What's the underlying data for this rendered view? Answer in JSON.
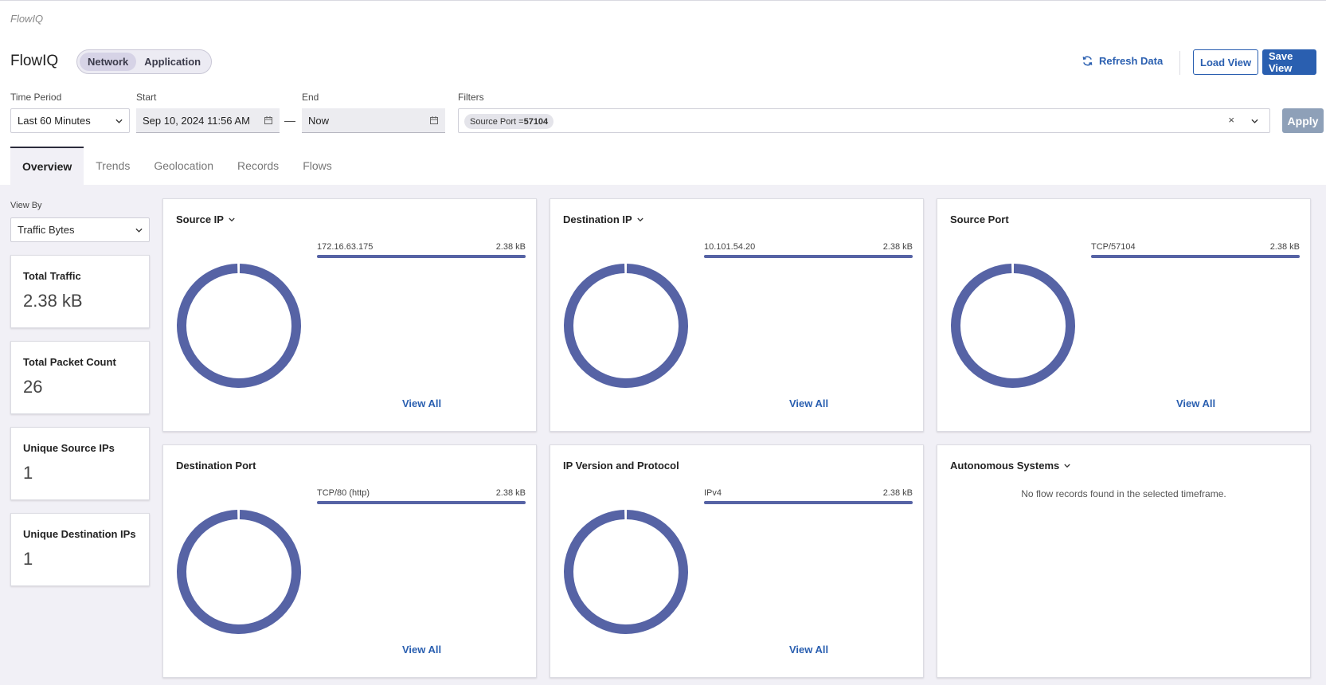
{
  "app": {
    "label": "FlowIQ",
    "title": "FlowIQ"
  },
  "header": {
    "segments": [
      "Network",
      "Application"
    ],
    "active_segment": "Network",
    "refresh_label": "Refresh Data",
    "load_view_label": "Load View",
    "save_view_label": "Save View"
  },
  "filters_bar": {
    "time_period_label": "Time Period",
    "time_period_value": "Last 60 Minutes",
    "start_label": "Start",
    "start_value": "Sep 10, 2024 11:56 AM",
    "range_separator": "—",
    "end_label": "End",
    "end_value": "Now",
    "filters_label": "Filters",
    "chip_key": "Source Port = ",
    "chip_value": "57104",
    "clear_symbol": "×",
    "apply_label": "Apply"
  },
  "tabs": [
    "Overview",
    "Trends",
    "Geolocation",
    "Records",
    "Flows"
  ],
  "active_tab": "Overview",
  "sidebar": {
    "view_by_label": "View By",
    "view_by_value": "Traffic Bytes",
    "stats": [
      {
        "title": "Total Traffic",
        "value": "2.38 kB"
      },
      {
        "title": "Total Packet Count",
        "value": "26"
      },
      {
        "title": "Unique Source IPs",
        "value": "1"
      },
      {
        "title": "Unique Destination IPs",
        "value": "1"
      }
    ]
  },
  "cards": [
    {
      "title": "Source IP",
      "has_dropdown": true,
      "item": "172.16.63.175",
      "value": "2.38 kB",
      "share": 1.0,
      "view_all": "View All"
    },
    {
      "title": "Destination IP",
      "has_dropdown": true,
      "item": "10.101.54.20",
      "value": "2.38 kB",
      "share": 1.0,
      "view_all": "View All"
    },
    {
      "title": "Source Port",
      "has_dropdown": false,
      "item": "TCP/57104",
      "value": "2.38 kB",
      "share": 1.0,
      "view_all": "View All"
    },
    {
      "title": "Destination Port",
      "has_dropdown": false,
      "item": "TCP/80 (http)",
      "value": "2.38 kB",
      "share": 1.0,
      "view_all": "View All"
    },
    {
      "title": "IP Version and Protocol",
      "has_dropdown": false,
      "item": "IPv4",
      "value": "2.38 kB",
      "share": 1.0,
      "view_all": "View All"
    },
    {
      "title": "Autonomous Systems",
      "has_dropdown": true,
      "empty_message": "No flow records found in the selected timeframe."
    }
  ],
  "colors": {
    "accent": "#2a5fb0",
    "chart": "#5663a5",
    "content_bg": "#f1f0f6"
  }
}
